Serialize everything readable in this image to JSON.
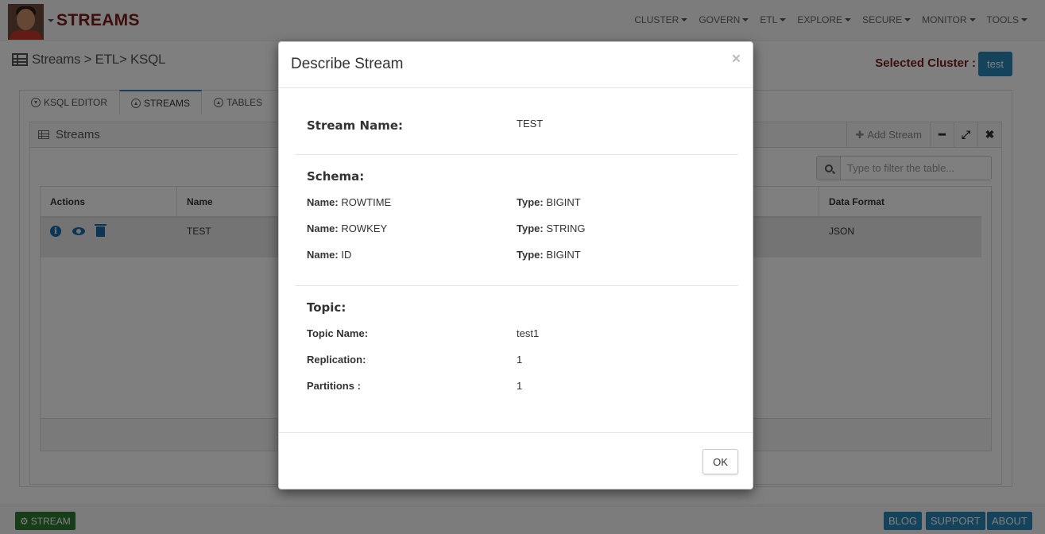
{
  "header": {
    "app_title": "STREAMS",
    "nav": [
      "CLUSTER",
      "GOVERN",
      "ETL",
      "EXPLORE",
      "SECURE",
      "MONITOR",
      "TOOLS"
    ]
  },
  "breadcrumb": "Streams > ETL> KSQL",
  "selected_cluster": {
    "label": "Selected Cluster :",
    "value": "test"
  },
  "tabs": [
    {
      "label": "KSQL EDITOR"
    },
    {
      "label": "STREAMS"
    },
    {
      "label": "TABLES"
    }
  ],
  "widget": {
    "title": "Streams",
    "add_label": "Add Stream",
    "filter_placeholder": "Type to filter the table..."
  },
  "table": {
    "columns": [
      "Actions",
      "Name",
      "Data Format"
    ],
    "rows": [
      {
        "name": "TEST",
        "data_format": "JSON"
      }
    ]
  },
  "footer": {
    "stream_label": "STREAM",
    "blog": "BLOG",
    "support": "SUPPORT",
    "about": "ABOUT"
  },
  "modal": {
    "title": "Describe Stream",
    "close": "×",
    "stream_name_label": "Stream Name:",
    "stream_name": "TEST",
    "schema_label": "Schema:",
    "schema": [
      {
        "name": "ROWTIME",
        "type": "BIGINT"
      },
      {
        "name": "ROWKEY",
        "type": "STRING"
      },
      {
        "name": "ID",
        "type": "BIGINT"
      }
    ],
    "name_prefix": "Name:",
    "type_prefix": "Type:",
    "topic_label": "Topic:",
    "topic_name_label": "Topic Name:",
    "topic_name": "test1",
    "replication_label": "Replication:",
    "replication": "1",
    "partitions_label": "Partitions :",
    "partitions": "1",
    "ok": "OK"
  },
  "colors": {
    "brand": "#7a1a1a",
    "accent": "#2a86b8",
    "icon_blue": "#1a6aa8",
    "stream_btn": "#2e7d32"
  }
}
